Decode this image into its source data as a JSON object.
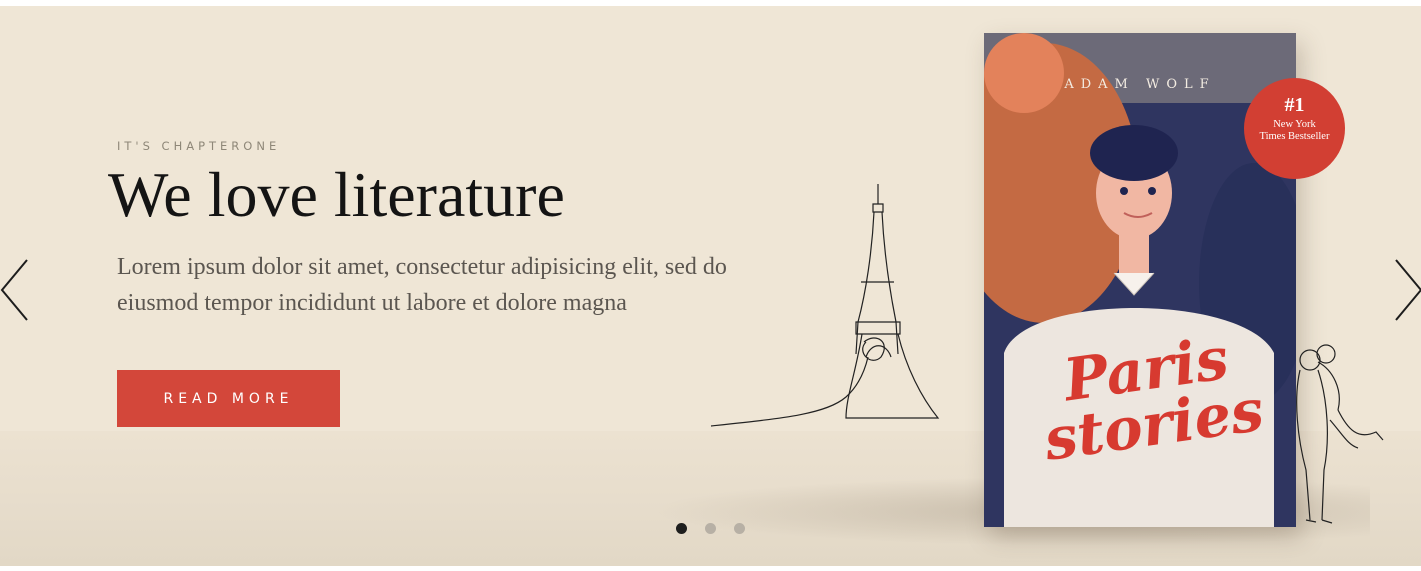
{
  "hero": {
    "eyebrow": "IT'S CHAPTERONE",
    "headline": "We love literature",
    "body": "Lorem ipsum dolor sit amet, consectetur adipisicing elit, sed do eiusmod tempor incididunt ut labore et dolore magna",
    "button_label": "READ MORE"
  },
  "book": {
    "author": "ADAM WOLF",
    "title_line1": "Paris",
    "title_line2": "stories",
    "badge_number": "#1",
    "badge_text": "New York Times Bestseller"
  },
  "carousel": {
    "slide_count": 3,
    "active_slide": 1
  },
  "colors": {
    "background": "#efe6d6",
    "accent": "#d3473a",
    "headline": "#141414",
    "body_text": "#5b5650"
  },
  "icons": {
    "prev": "chevron-left-icon",
    "next": "chevron-right-icon"
  }
}
